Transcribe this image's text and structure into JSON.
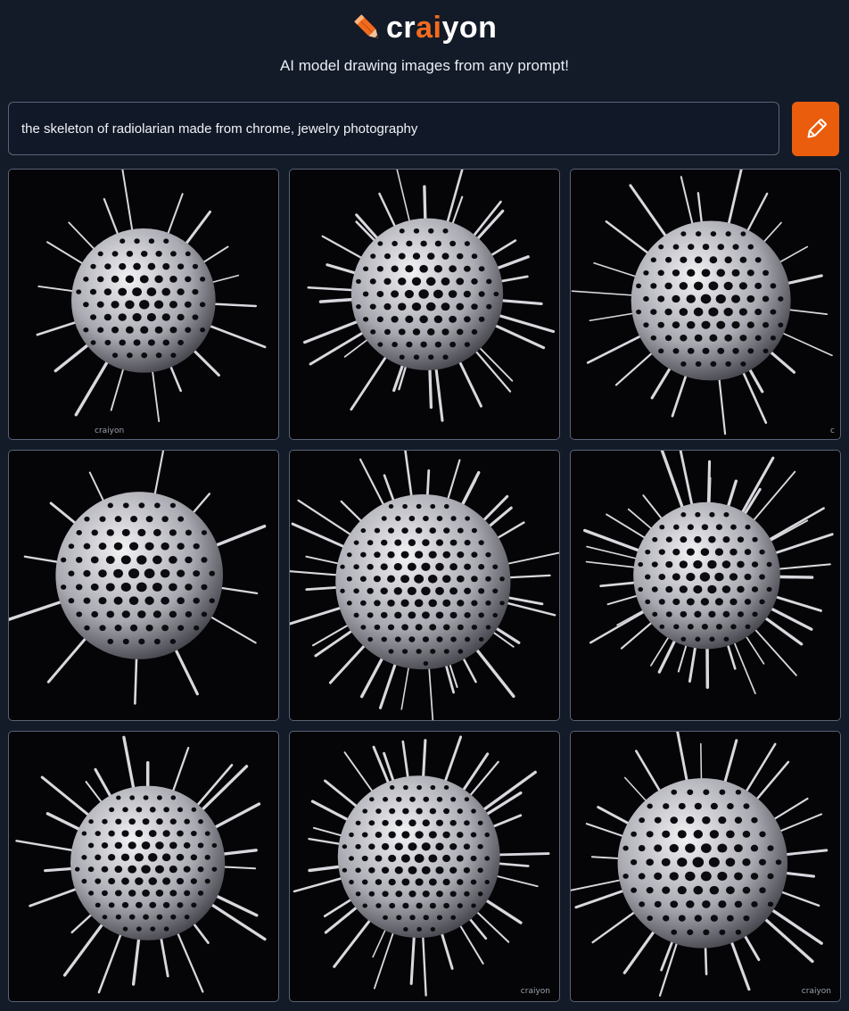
{
  "app": {
    "logo_text_part1": "cr",
    "logo_text_accent": "ai",
    "logo_text_part2": "yon",
    "logo_icon": "pencil-icon",
    "tagline": "AI model drawing images from any prompt!"
  },
  "prompt": {
    "value": "the skeleton of radiolarian made from chrome, jewelry photography",
    "draw_icon": "pencil-icon"
  },
  "colors": {
    "background": "#131a28",
    "accent": "#ea5d0c",
    "tile_border": "#5a6376"
  },
  "results": [
    {
      "id": "result-1",
      "spikes": 18,
      "watermark": "craiyon"
    },
    {
      "id": "result-2",
      "spikes": 30
    },
    {
      "id": "result-3",
      "spikes": 22,
      "watermark": "c"
    },
    {
      "id": "result-4",
      "spikes": 12
    },
    {
      "id": "result-5",
      "spikes": 34
    },
    {
      "id": "result-6",
      "spikes": 36
    },
    {
      "id": "result-7",
      "spikes": 24
    },
    {
      "id": "result-8",
      "spikes": 32,
      "watermark": "craiyon"
    },
    {
      "id": "result-9",
      "spikes": 26,
      "watermark": "craiyon"
    }
  ]
}
